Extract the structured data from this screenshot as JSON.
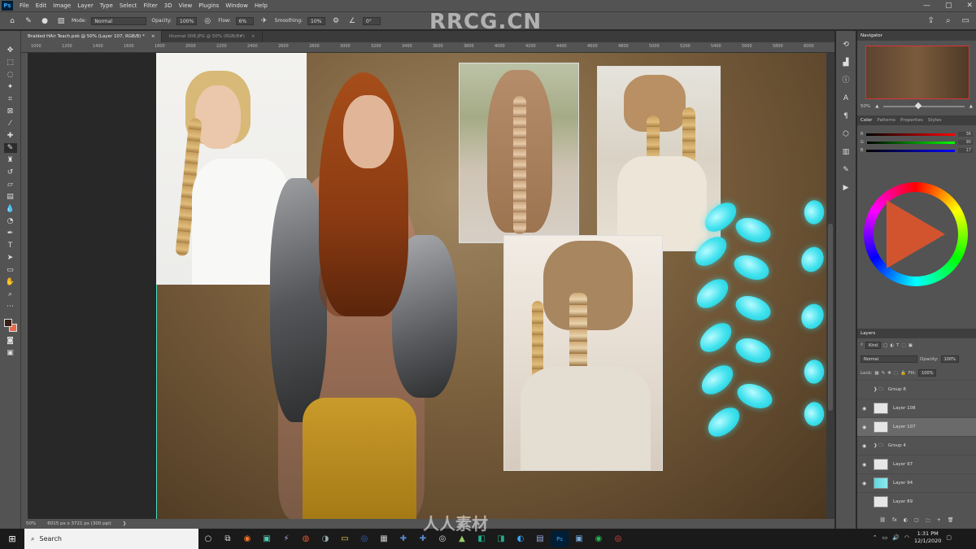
{
  "menubar": {
    "logo": "Ps",
    "items": [
      "File",
      "Edit",
      "Image",
      "Layer",
      "Type",
      "Select",
      "Filter",
      "3D",
      "View",
      "Plugins",
      "Window",
      "Help"
    ],
    "window_controls": [
      "—",
      "▢",
      "✕"
    ]
  },
  "options": {
    "mode_label": "Mode:",
    "mode_value": "Normal",
    "opacity_label": "Opacity:",
    "opacity_value": "100%",
    "flow_label": "Flow:",
    "flow_value": "6%",
    "smoothing_label": "Smoothing:",
    "smoothing_value": "10%",
    "angle_value": "0°"
  },
  "watermark_top": "RRCG.CN",
  "tabs": [
    {
      "label": "Braided HAir Teach.psb @ 50% (Layer 107, RGB/8) *",
      "close": "×"
    },
    {
      "label": "hhsmwl 008.JPG @ 50% (RGB/8#)",
      "close": "×"
    }
  ],
  "ruler_ticks": [
    "1000",
    "1200",
    "1400",
    "1600",
    "1800",
    "2000",
    "2200",
    "2400",
    "2600",
    "2800",
    "3000",
    "3200",
    "3400",
    "3600",
    "3800",
    "4000",
    "4200",
    "4400",
    "4600",
    "4800",
    "5000",
    "5200",
    "5400",
    "5600",
    "5800",
    "6000"
  ],
  "status": {
    "zoom": "50%",
    "doc_info": "6015 px x 3721 px (300 ppi)",
    "arrow": "❯"
  },
  "panels": {
    "navigator_title": "Navigator",
    "nav_zoom": "50%",
    "color_tabs": [
      "Color",
      "Patterns",
      "Properties",
      "Styles"
    ],
    "color_values": {
      "r": "36",
      "g": "90",
      "b": "17"
    },
    "color_letters": {
      "r": "R",
      "g": "G",
      "b": "B"
    },
    "fg_color": "#3a1f14",
    "bg_color": "#e46b4e",
    "layers_title": "Layers",
    "kind_label": "Kind",
    "blend_mode": "Normal",
    "opacity_label": "Opacity:",
    "opacity_value": "100%",
    "lock_label": "Lock:",
    "fill_label": "Fill:",
    "fill_value": "100%",
    "layers": [
      {
        "name": "Group 8",
        "type": "group"
      },
      {
        "name": "Layer 108",
        "type": "layer"
      },
      {
        "name": "Layer 107",
        "type": "layer",
        "selected": true
      },
      {
        "name": "Group 4",
        "type": "group"
      },
      {
        "name": "Layer 97",
        "type": "layer"
      },
      {
        "name": "Layer 94",
        "type": "layer-cyan"
      },
      {
        "name": "Layer 89",
        "type": "layer"
      }
    ],
    "footer_icons": [
      "fx",
      "◐",
      "▢",
      "🗀",
      "+",
      "🗑"
    ]
  },
  "taskbar": {
    "search_placeholder": "Search",
    "time": "1:31 PM",
    "date": "12/1/2020"
  },
  "watermark_bottom": "人人素材"
}
